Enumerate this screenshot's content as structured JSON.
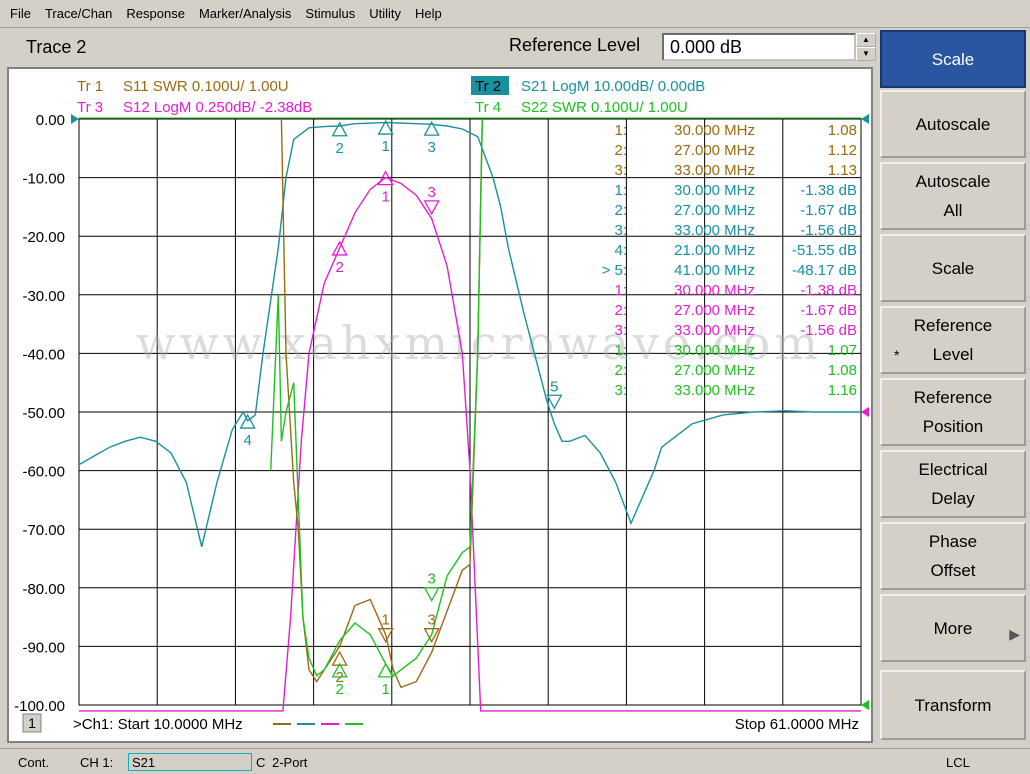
{
  "menu": [
    "File",
    "Trace/Chan",
    "Response",
    "Marker/Analysis",
    "Stimulus",
    "Utility",
    "Help"
  ],
  "header": {
    "title": "Trace 2",
    "field_label": "Reference Level",
    "field_value": "0.000 dB"
  },
  "softkeys": [
    {
      "label": "Scale",
      "active": true
    },
    {
      "label": "Autoscale"
    },
    {
      "label": "Autoscale\nAll"
    },
    {
      "label": "Scale"
    },
    {
      "label": "Reference\nLevel",
      "marked": true
    },
    {
      "label": "Reference\nPosition"
    },
    {
      "label": "Electrical\nDelay"
    },
    {
      "label": "Phase\nOffset"
    },
    {
      "label": "More",
      "submenu": true
    },
    {
      "label": "Transform"
    }
  ],
  "status": {
    "mode": "Cont.",
    "channel": "CH 1:",
    "measurement": "S21",
    "flag": "C",
    "port": "2-Port",
    "remote": "LCL"
  },
  "watermark": "www.xahxmicrowave.com",
  "chart_data": {
    "type": "line",
    "start_label": ">Ch1: Start  10.0000 MHz",
    "stop_label": "Stop  61.0000 MHz",
    "channel_tag": "1",
    "x_range": [
      10,
      61
    ],
    "x_unit": "MHz",
    "y_range": [
      -100,
      0
    ],
    "y_ticks": [
      "0.00",
      "-10.00",
      "-20.00",
      "-30.00",
      "-40.00",
      "-50.00",
      "-60.00",
      "-70.00",
      "-80.00",
      "-90.00",
      "-100.00"
    ],
    "grid": true,
    "traces": [
      {
        "id": "Tr 1",
        "label": "S11 SWR 0.100U/  1.00U",
        "color": "#9a6a10",
        "active": false
      },
      {
        "id": "Tr 2",
        "label": "S21 LogM 10.00dB/  0.00dB",
        "color": "#1890a0",
        "active": true
      },
      {
        "id": "Tr 3",
        "label": "S12 LogM 0.250dB/  -2.38dB",
        "color": "#e020d0",
        "active": false
      },
      {
        "id": "Tr 4",
        "label": "S22 SWR 0.100U/  1.00U",
        "color": "#20c020",
        "active": false
      }
    ],
    "series": [
      {
        "name": "S21 LogM",
        "color": "#1890a0",
        "x": [
          10,
          11,
          12,
          13,
          14,
          15,
          16,
          17,
          18,
          19,
          20,
          20.7,
          21,
          21.5,
          22,
          23,
          23.5,
          24,
          25,
          26,
          27,
          28,
          30,
          32,
          33,
          34,
          35,
          36,
          37,
          37.5,
          38,
          39,
          40,
          40.5,
          41,
          41.5,
          42,
          43,
          44,
          45,
          46,
          47,
          47.5,
          48,
          49,
          50,
          52,
          54,
          56,
          58,
          60,
          61
        ],
        "y": [
          -59,
          -57.5,
          -56,
          -55,
          -54.3,
          -55,
          -57,
          -62,
          -73,
          -62,
          -53,
          -50,
          -51.5,
          -50.5,
          -40,
          -22,
          -10,
          -3.5,
          -1.5,
          -1.3,
          -1.2,
          -0.8,
          -0.6,
          -0.8,
          -0.9,
          -1.2,
          -1.7,
          -3,
          -10,
          -15,
          -22,
          -33,
          -43,
          -48,
          -52,
          -55,
          -55,
          -54,
          -57,
          -62,
          -69,
          -63,
          -60,
          -56,
          -54,
          -52,
          -50.5,
          -50,
          -49.8,
          -50,
          -50,
          -50
        ]
      },
      {
        "name": "S12 LogM",
        "color": "#e020d0",
        "x": [
          10,
          23.3,
          23.8,
          24.5,
          25,
          26,
          27,
          28,
          29,
          30,
          31,
          32,
          33,
          34,
          35,
          35.5,
          36.2,
          36.5,
          61
        ],
        "y": [
          -101,
          -101,
          -85,
          -55,
          -40,
          -28,
          -22,
          -16,
          -12,
          -10,
          -11,
          -13,
          -17,
          -25,
          -40,
          -60,
          -101,
          -101,
          -101
        ]
      },
      {
        "name": "S11 SWR",
        "color": "#9a6a10",
        "x": [
          23.2,
          23.5,
          24,
          24.3,
          24.6,
          25,
          25.5,
          26,
          27,
          28,
          29,
          30,
          30.5,
          31,
          32,
          33,
          34,
          35,
          35.5,
          36,
          36.3
        ],
        "y": [
          0,
          -40,
          -62,
          -70,
          -85,
          -94,
          -96,
          -94,
          -90,
          -83,
          -82,
          -88,
          -94,
          -97,
          -96,
          -91,
          -84,
          -77,
          -76,
          -40,
          0
        ]
      },
      {
        "name": "S22 SWR",
        "color": "#20c020",
        "x": [
          22.5,
          23,
          23.2,
          23.5,
          24,
          24.3,
          24.6,
          25,
          25.5,
          26,
          27,
          28,
          29,
          30,
          30.5,
          31,
          32,
          33,
          34,
          35,
          35.5,
          36,
          36.3
        ],
        "y": [
          -60,
          -30,
          -55,
          -50,
          -45,
          -65,
          -85,
          -92,
          -95,
          -94,
          -89,
          -86,
          -88,
          -93,
          -95,
          -94,
          -92,
          -88,
          -78,
          -74,
          -73,
          -40,
          0
        ]
      }
    ],
    "markers": [
      {
        "id": "1",
        "trace": "S21",
        "x": 30,
        "y": -1.38,
        "dir": "up"
      },
      {
        "id": "2",
        "trace": "S21",
        "x": 27,
        "y": -1.67,
        "dir": "up"
      },
      {
        "id": "3",
        "trace": "S21",
        "x": 33,
        "y": -1.56,
        "dir": "up"
      },
      {
        "id": "4",
        "trace": "S21",
        "x": 21,
        "y": -51.55,
        "dir": "up"
      },
      {
        "id": "5",
        "trace": "S21",
        "x": 41,
        "y": -48.17,
        "dir": "down"
      },
      {
        "id": "1",
        "trace": "S12",
        "x": 30,
        "y": -10,
        "dir": "up"
      },
      {
        "id": "2",
        "trace": "S12",
        "x": 27,
        "y": -22,
        "dir": "up"
      },
      {
        "id": "3",
        "trace": "S12",
        "x": 33,
        "y": -15,
        "dir": "down"
      },
      {
        "id": "1",
        "trace": "S11",
        "x": 30,
        "y": -88,
        "dir": "down"
      },
      {
        "id": "2",
        "trace": "S11",
        "x": 27,
        "y": -92,
        "dir": "up"
      },
      {
        "id": "3",
        "trace": "S11",
        "x": 33,
        "y": -88,
        "dir": "down"
      },
      {
        "id": "1",
        "trace": "S22",
        "x": 30,
        "y": -94,
        "dir": "up"
      },
      {
        "id": "2",
        "trace": "S22",
        "x": 27,
        "y": -94,
        "dir": "up"
      },
      {
        "id": "3",
        "trace": "S22",
        "x": 33,
        "y": -81,
        "dir": "down"
      }
    ],
    "marker_table": [
      {
        "id": "1:",
        "freq": "30.000 MHz",
        "value": "1.08",
        "color": "#9a6a10"
      },
      {
        "id": "2:",
        "freq": "27.000 MHz",
        "value": "1.12",
        "color": "#9a6a10"
      },
      {
        "id": "3:",
        "freq": "33.000 MHz",
        "value": "1.13",
        "color": "#9a6a10"
      },
      {
        "id": "1:",
        "freq": "30.000 MHz",
        "value": "-1.38 dB",
        "color": "#1890a0"
      },
      {
        "id": "2:",
        "freq": "27.000 MHz",
        "value": "-1.67 dB",
        "color": "#1890a0"
      },
      {
        "id": "3:",
        "freq": "33.000 MHz",
        "value": "-1.56 dB",
        "color": "#1890a0"
      },
      {
        "id": "4:",
        "freq": "21.000 MHz",
        "value": "-51.55 dB",
        "color": "#1890a0"
      },
      {
        "id": "> 5:",
        "freq": "41.000 MHz",
        "value": "-48.17 dB",
        "color": "#1890a0"
      },
      {
        "id": "1:",
        "freq": "30.000 MHz",
        "value": "-1.38 dB",
        "color": "#e020d0"
      },
      {
        "id": "2:",
        "freq": "27.000 MHz",
        "value": "-1.67 dB",
        "color": "#e020d0"
      },
      {
        "id": "3:",
        "freq": "33.000 MHz",
        "value": "-1.56 dB",
        "color": "#e020d0"
      },
      {
        "id": "1:",
        "freq": "30.000 MHz",
        "value": "1.07",
        "color": "#20c020"
      },
      {
        "id": "2:",
        "freq": "27.000 MHz",
        "value": "1.08",
        "color": "#20c020"
      },
      {
        "id": "3:",
        "freq": "33.000 MHz",
        "value": "1.16",
        "color": "#20c020"
      }
    ]
  }
}
